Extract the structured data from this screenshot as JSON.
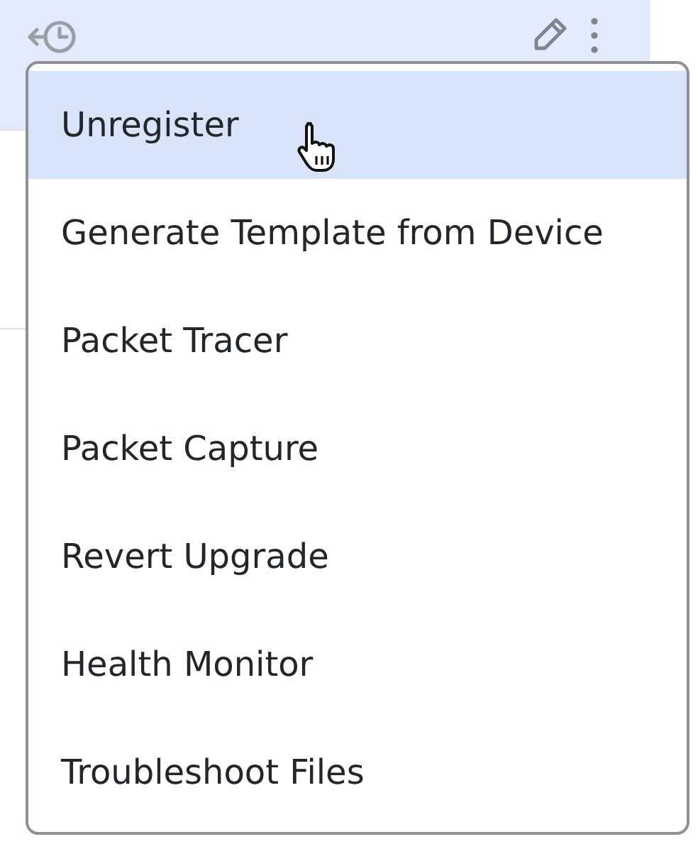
{
  "menu": {
    "items": [
      {
        "label": "Unregister",
        "selected": true
      },
      {
        "label": "Generate Template from Device",
        "selected": false
      },
      {
        "label": "Packet Tracer",
        "selected": false
      },
      {
        "label": "Packet Capture",
        "selected": false
      },
      {
        "label": "Revert Upgrade",
        "selected": false
      },
      {
        "label": "Health Monitor",
        "selected": false
      },
      {
        "label": "Troubleshoot Files",
        "selected": false
      }
    ]
  }
}
